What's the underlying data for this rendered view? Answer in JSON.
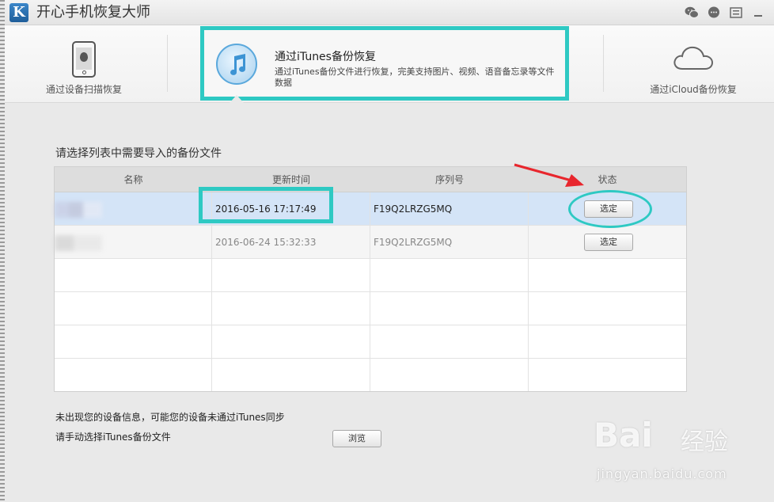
{
  "window": {
    "logo_letter": "K",
    "title": "开心手机恢复大师",
    "controls": [
      "wechat-icon",
      "chat-icon",
      "menu-icon",
      "minimize-icon"
    ]
  },
  "toolbar": {
    "device": {
      "label": "通过设备扫描恢复"
    },
    "itunes": {
      "title": "通过iTunes备份恢复",
      "description": "通过iTunes备份文件进行恢复，完美支持图片、视频、语音备忘录等文件数据"
    },
    "icloud": {
      "label": "通过iCloud备份恢复"
    }
  },
  "main": {
    "section_title": "请选择列表中需要导入的备份文件",
    "table": {
      "columns": [
        "名称",
        "更新时间",
        "序列号",
        "状态"
      ],
      "rows": [
        {
          "name": "",
          "time": "2016-05-16 17:17:49",
          "serial": "F19Q2LRZG5MQ",
          "action": "选定",
          "selected": true
        },
        {
          "name": "",
          "time": "2016-06-24 15:32:33",
          "serial": "F19Q2LRZG5MQ",
          "action": "选定",
          "selected": false
        }
      ],
      "empty_rows": 4
    },
    "note_line1": "未出现您的设备信息，可能您的设备未通过iTunes同步",
    "note_line2": "请手动选择iTunes备份文件",
    "browse_label": "浏览"
  },
  "watermark": {
    "brand": "Bai",
    "brand_suffix": "经验",
    "url": "jingyan.baidu.com"
  },
  "colors": {
    "highlight": "#2ec9c3",
    "selected_row": "#d4e4f7",
    "arrow": "#e8262d"
  }
}
